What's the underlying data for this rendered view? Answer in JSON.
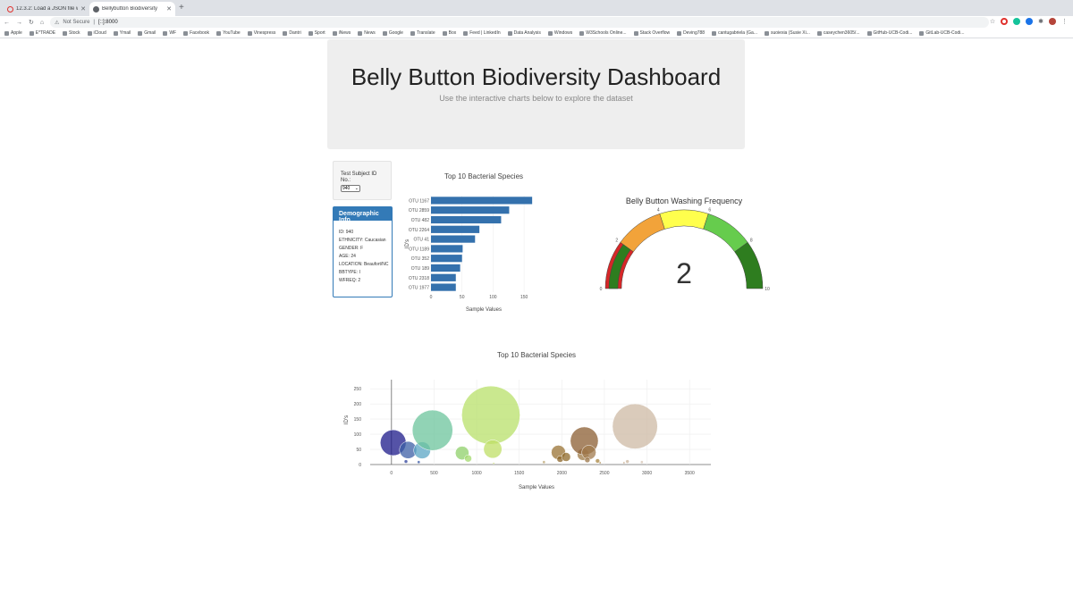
{
  "browser": {
    "tabs": [
      {
        "title": "12.3.2: Load a JSON file with ...",
        "active": false
      },
      {
        "title": "Bellybutton Biodiversity",
        "active": true
      }
    ],
    "security": "Not Secure",
    "url": "[::]:8000",
    "bookmarks": [
      "Apple",
      "E*TRADE",
      "Stock",
      "iCloud",
      "Ymail",
      "Gmail",
      "WF",
      "Facebook",
      "YouTube",
      "Vinespress",
      "Dantri",
      "Sport",
      "iNews",
      "News",
      "Google",
      "Translate",
      "Box",
      "Feed | LinkedIn",
      "Data Analysis",
      "Windows",
      "W3Schools Online...",
      "Stack Overflow",
      "Deving788",
      "cantugabriela (Ga...",
      "suoiexia (Susie Xi...",
      "caseychen3605/...",
      "GitHub-UCB-Codi...",
      "GitLab-UCB-Codi..."
    ]
  },
  "header": {
    "title": "Belly Button Biodiversity Dashboard",
    "subtitle": "Use the interactive charts below to explore the dataset"
  },
  "selector": {
    "label": "Test Subject ID No.:",
    "value": "940"
  },
  "demographics": {
    "heading": "Demographic Info",
    "lines": [
      "ID: 940",
      "ETHNICITY: Caucasian",
      "GENDER: F",
      "AGE: 24",
      "LOCATION: Beaufort/NC",
      "BBTYPE: I",
      "WFREQ: 2"
    ]
  },
  "colors": {
    "panel": "#337ab7",
    "bar": "#3471ad"
  },
  "chart_data": [
    {
      "type": "bar",
      "orientation": "horizontal",
      "title": "Top 10 Bacterial Species",
      "xlabel": "Sample Values",
      "ylabel": "ID's",
      "categories": [
        "OTU 1167",
        "OTU 2859",
        "OTU 482",
        "OTU 2264",
        "OTU 41",
        "OTU 1189",
        "OTU 352",
        "OTU 189",
        "OTU 2318",
        "OTU 1977"
      ],
      "values": [
        163,
        126,
        113,
        78,
        71,
        51,
        50,
        47,
        40,
        40
      ],
      "xlim": [
        0,
        170
      ],
      "xticks": [
        0,
        50,
        100,
        150
      ]
    },
    {
      "type": "gauge",
      "title": "Belly Button Washing Frequency",
      "value": 2,
      "range": [
        0,
        10
      ],
      "tick_labels": [
        "0",
        "2",
        "4",
        "6",
        "8",
        "10"
      ],
      "bands": [
        {
          "from": 0,
          "to": 2,
          "color": "#d62728"
        },
        {
          "from": 2,
          "to": 4,
          "color": "#f2a33a"
        },
        {
          "from": 4,
          "to": 6,
          "color": "#ffff4d"
        },
        {
          "from": 6,
          "to": 8,
          "color": "#66cc4d"
        },
        {
          "from": 8,
          "to": 10,
          "color": "#2e7d1f"
        }
      ],
      "indicator_color": "#2e7d1f"
    },
    {
      "type": "scatter",
      "title": "Top 10 Bacterial Species",
      "xlabel": "Sample Values",
      "ylabel": "ID's",
      "xlim": [
        -250,
        3750
      ],
      "ylim": [
        0,
        280
      ],
      "xticks": [
        0,
        500,
        1000,
        1500,
        2000,
        2500,
        3000,
        3500
      ],
      "yticks": [
        0,
        50,
        100,
        150,
        200,
        250
      ],
      "points": [
        {
          "x": 20,
          "y": 72,
          "s": 72,
          "c": "#1c1a8a"
        },
        {
          "x": 195,
          "y": 48,
          "s": 48,
          "c": "#3c5fa6"
        },
        {
          "x": 170,
          "y": 10,
          "s": 10,
          "c": "#2b3f9a"
        },
        {
          "x": 320,
          "y": 8,
          "s": 8,
          "c": "#2c4d9f"
        },
        {
          "x": 360,
          "y": 47,
          "s": 47,
          "c": "#5ba6c4"
        },
        {
          "x": 482,
          "y": 113,
          "s": 113,
          "c": "#6cc49c"
        },
        {
          "x": 830,
          "y": 38,
          "s": 38,
          "c": "#8fd06a"
        },
        {
          "x": 900,
          "y": 20,
          "s": 20,
          "c": "#a3da6c"
        },
        {
          "x": 1167,
          "y": 163,
          "s": 163,
          "c": "#b8e06a"
        },
        {
          "x": 1189,
          "y": 51,
          "s": 51,
          "c": "#bfdf66"
        },
        {
          "x": 1200,
          "y": 4,
          "s": 4,
          "c": "#c7dc6a"
        },
        {
          "x": 1790,
          "y": 8,
          "s": 8,
          "c": "#b8a06a"
        },
        {
          "x": 1960,
          "y": 40,
          "s": 40,
          "c": "#9a7334"
        },
        {
          "x": 1980,
          "y": 18,
          "s": 18,
          "c": "#8b6427"
        },
        {
          "x": 2050,
          "y": 25,
          "s": 25,
          "c": "#8f6a2a"
        },
        {
          "x": 2250,
          "y": 33,
          "s": 33,
          "c": "#9d7a44"
        },
        {
          "x": 2264,
          "y": 78,
          "s": 78,
          "c": "#8b5e31"
        },
        {
          "x": 2318,
          "y": 40,
          "s": 40,
          "c": "#a27b4d"
        },
        {
          "x": 2300,
          "y": 15,
          "s": 15,
          "c": "#9a7446"
        },
        {
          "x": 2420,
          "y": 12,
          "s": 12,
          "c": "#a8843f"
        },
        {
          "x": 2450,
          "y": 6,
          "s": 6,
          "c": "#b19258"
        },
        {
          "x": 2730,
          "y": 6,
          "s": 6,
          "c": "#c5ab8c"
        },
        {
          "x": 2770,
          "y": 10,
          "s": 10,
          "c": "#c9b49c"
        },
        {
          "x": 2859,
          "y": 126,
          "s": 126,
          "c": "#cdb9a4"
        },
        {
          "x": 2940,
          "y": 8,
          "s": 8,
          "c": "#d3c2b0"
        }
      ]
    }
  ]
}
